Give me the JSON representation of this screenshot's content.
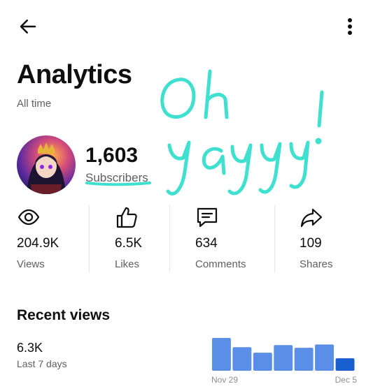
{
  "header": {
    "back_icon": "arrow-left-icon",
    "menu_icon": "more-vert-icon",
    "title": "Analytics",
    "period": "All time"
  },
  "channel": {
    "subscribers": "1,603",
    "subscribers_label": "Subscribers"
  },
  "stats": [
    {
      "icon": "eye-icon",
      "value": "204.9K",
      "label": "Views"
    },
    {
      "icon": "thumbs-up-icon",
      "value": "6.5K",
      "label": "Likes"
    },
    {
      "icon": "comment-icon",
      "value": "634",
      "label": "Comments"
    },
    {
      "icon": "share-icon",
      "value": "109",
      "label": "Shares"
    }
  ],
  "recent": {
    "title": "Recent views",
    "value": "6.3K",
    "period": "Last 7 days"
  },
  "chart_data": {
    "type": "bar",
    "categories": [
      "Nov 29",
      "",
      "",
      "",
      "",
      "",
      "Dec 5"
    ],
    "values": [
      1.0,
      0.72,
      0.55,
      0.78,
      0.7,
      0.8,
      0.38
    ],
    "x_tick_labels": [
      "Nov 29",
      "Dec 5"
    ],
    "colors": {
      "bar": "#5b8ee6",
      "highlight": "#1a5fd0"
    }
  },
  "doodle_text": "Oh yayy!",
  "colors": {
    "doodle": "#3fe0d0",
    "muted_text": "#606060"
  }
}
